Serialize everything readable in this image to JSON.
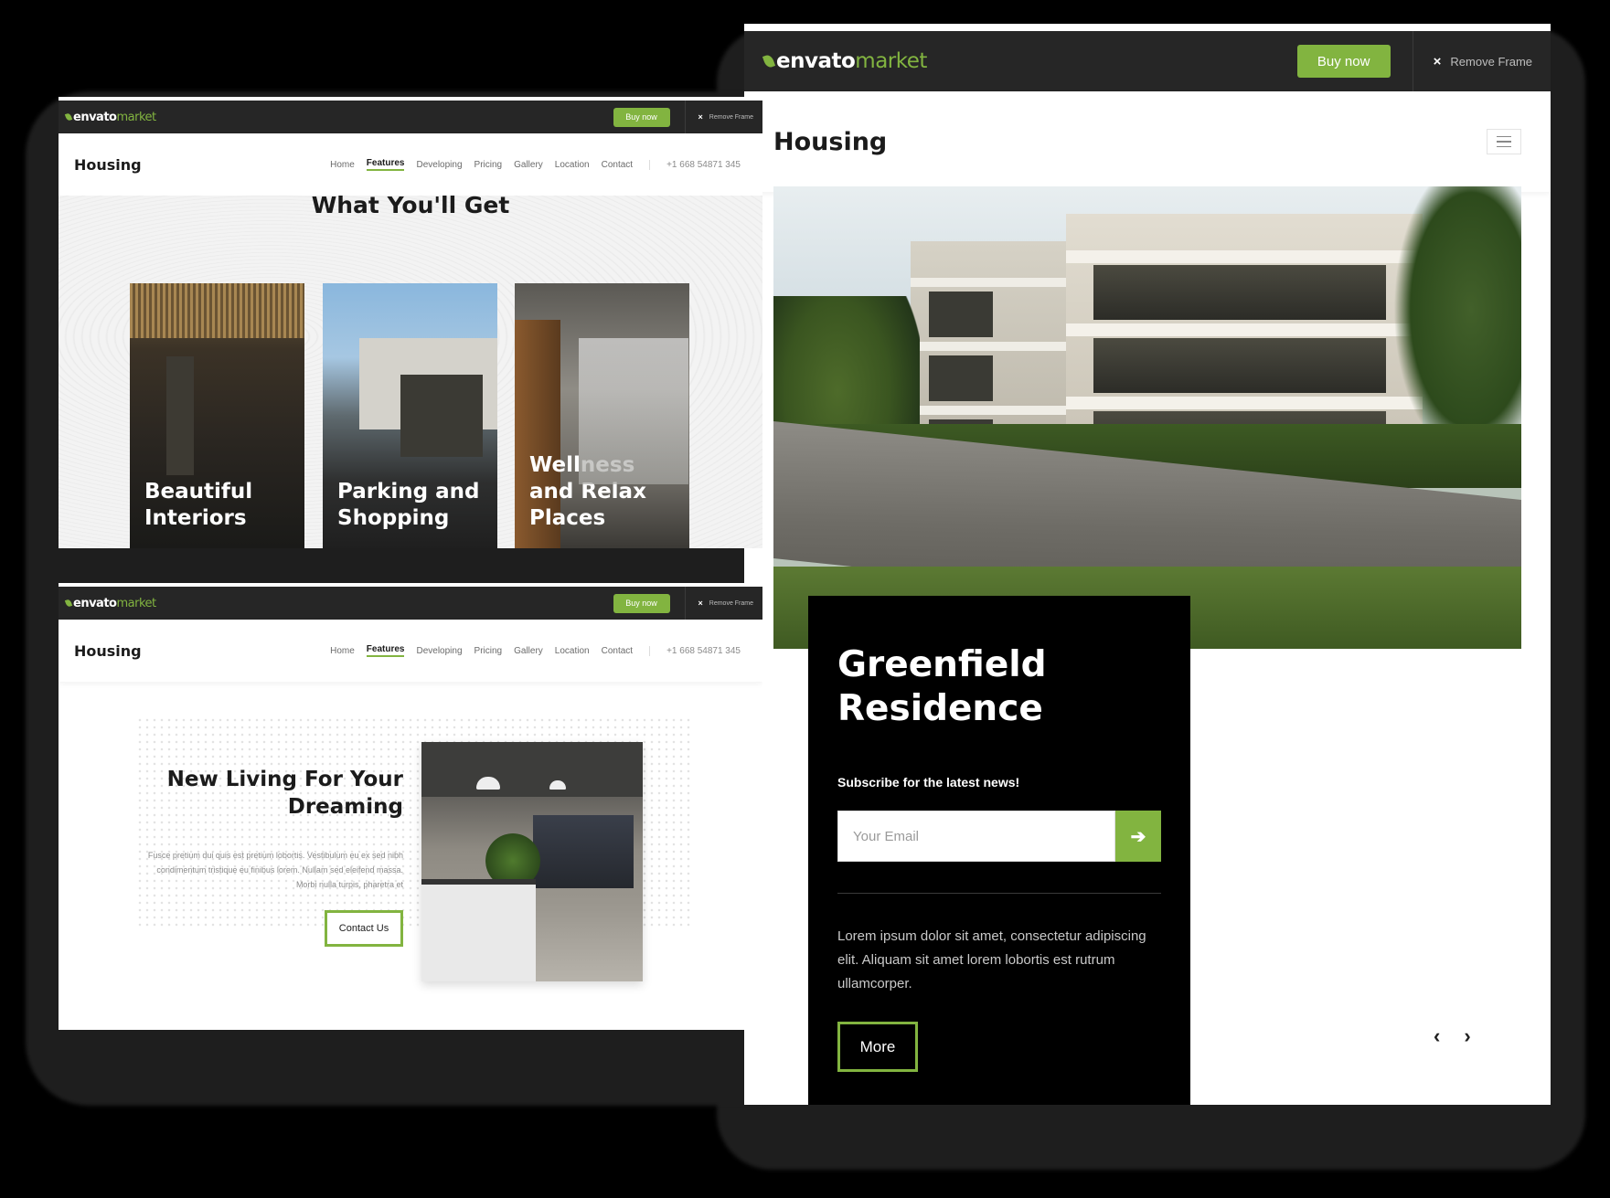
{
  "colors": {
    "accent": "#82b440",
    "bar": "#262626",
    "card": "#000000"
  },
  "envato": {
    "logo_word1": "envato",
    "logo_word2": "market",
    "buy_label": "Buy now",
    "remove_label": "Remove Frame",
    "close_icon": "×"
  },
  "site": {
    "title": "Housing",
    "nav": [
      "Home",
      "Features",
      "Developing",
      "Pricing",
      "Gallery",
      "Location",
      "Contact"
    ],
    "active_nav": "Features",
    "phone": "+1 668 54871 345"
  },
  "hero": {
    "title_line1": "Greenfield",
    "title_line2": "Residence",
    "subscribe_label": "Subscribe for the latest news!",
    "email_placeholder": "Your Email",
    "submit_icon": "arrow-right-icon",
    "body": "Lorem ipsum dolor sit amet, consectetur adipiscing elit. Aliquam sit amet lorem lobortis est rutrum ullamcorper.",
    "more_label": "More",
    "prev_icon": "‹",
    "next_icon": "›"
  },
  "features": {
    "heading": "What You'll Get",
    "cards": [
      {
        "line1": "Beautiful",
        "line2": "Interiors",
        "line3": ""
      },
      {
        "line1": "Parking and",
        "line2": "Shopping",
        "line3": ""
      },
      {
        "line1": "Wellness",
        "line2": "and Relax",
        "line3": "Places"
      }
    ]
  },
  "living": {
    "title_line1": "New Living For Your",
    "title_line2": "Dreaming",
    "body": "Fusce pretium dui quis est pretium lobortis. Vestibulum eu ex sed nibh condimentum tristique eu finibus lorem. Nullam sed eleifend massa. Morbi nulla turpis, pharetra et",
    "button_label": "Contact Us"
  }
}
